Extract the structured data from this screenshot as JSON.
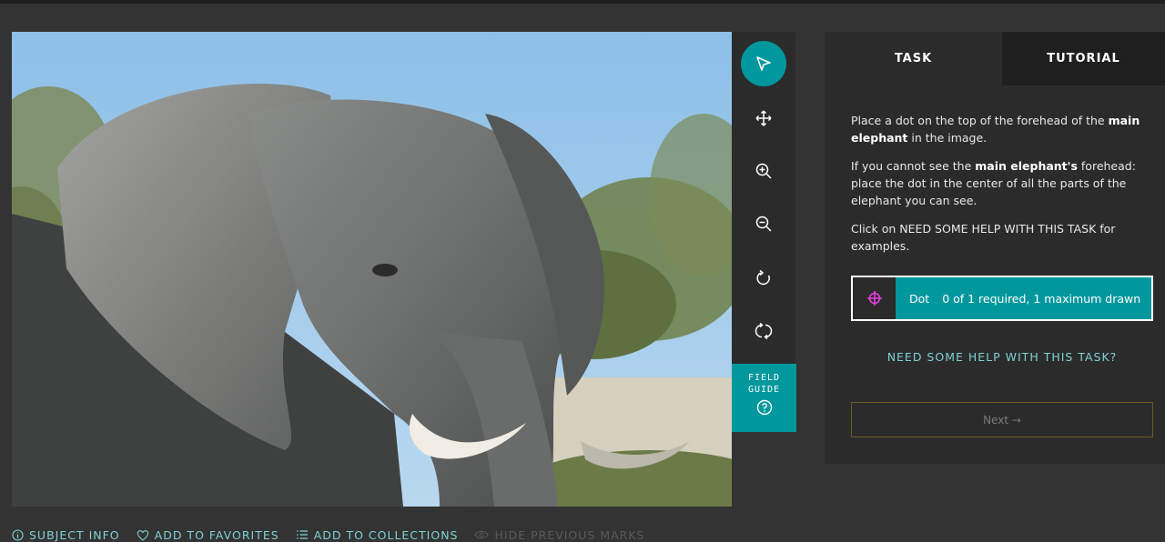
{
  "toolbar": {
    "tools": [
      {
        "name": "annotate",
        "icon": "pointer-arrow-icon",
        "active": true
      },
      {
        "name": "move",
        "icon": "move-arrows-icon"
      },
      {
        "name": "zoom-in",
        "icon": "zoom-in-icon"
      },
      {
        "name": "zoom-out",
        "icon": "zoom-out-icon"
      },
      {
        "name": "rotate",
        "icon": "rotate-icon"
      },
      {
        "name": "reset",
        "icon": "reset-icon"
      }
    ],
    "field_guide_line1": "FIELD",
    "field_guide_line2": "GUIDE",
    "field_guide_icon": "question-circle-icon"
  },
  "subject": {
    "icon": "elephant-photo"
  },
  "task_panel": {
    "tabs": {
      "task": "TASK",
      "tutorial": "TUTORIAL"
    },
    "instructions": {
      "p1_pre": "Place a dot on the top of the forehead of the ",
      "p1_bold": "main elephant",
      "p1_post": " in the image.",
      "p2_pre": "If you cannot see the ",
      "p2_bold": "main elephant's",
      "p2_post": " forehead: place the dot in the center of all the parts of the elephant you can see.",
      "p3": "Click on NEED SOME HELP WITH THIS TASK for examples."
    },
    "dot_tool": {
      "label": "Dot",
      "count_text": "0 of 1 required, 1 maximum drawn",
      "color": "#e040e0",
      "icon": "crosshair-icon"
    },
    "help_link": "NEED SOME HELP WITH THIS TASK?",
    "next_button": "Next →"
  },
  "bottom_bar": {
    "subject_info": "SUBJECT INFO",
    "add_favorites": "ADD TO FAVORITES",
    "add_collections": "ADD TO COLLECTIONS",
    "hide_marks": "HIDE PREVIOUS MARKS"
  },
  "colors": {
    "accent": "#00979d",
    "background": "#333333",
    "panel": "#2b2b2b",
    "link": "#7fd0d4"
  }
}
